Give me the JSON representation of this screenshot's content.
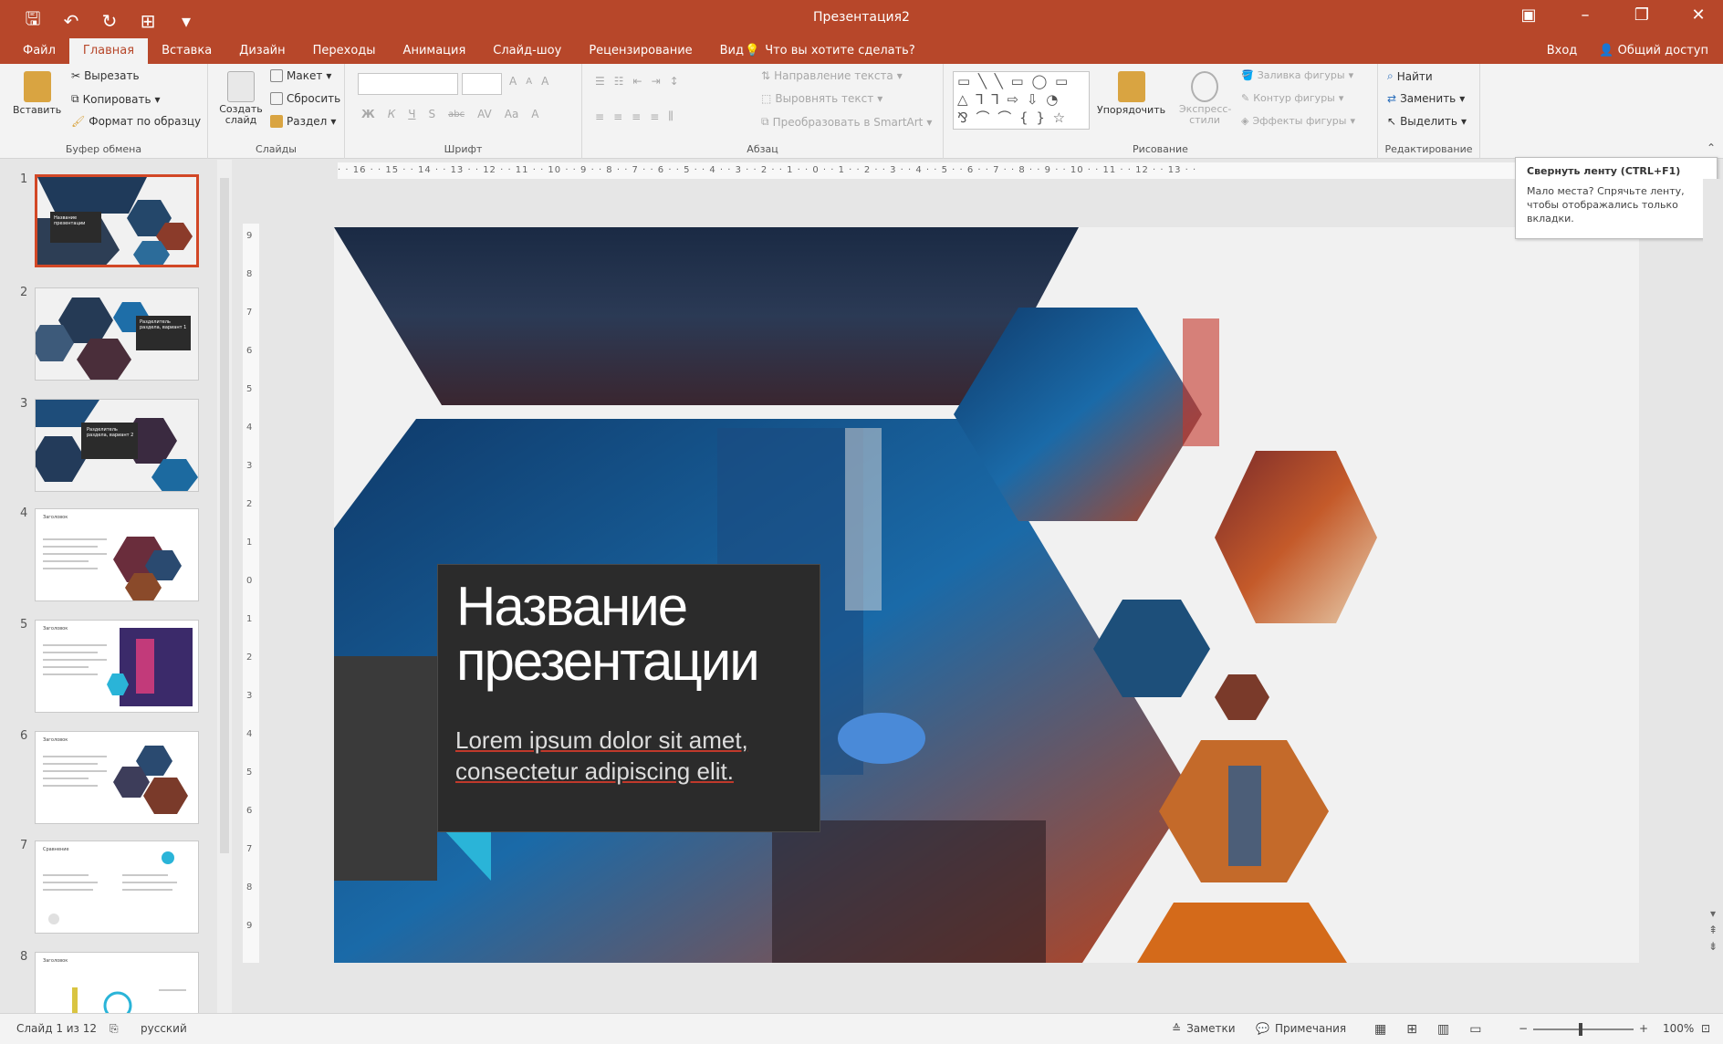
{
  "window": {
    "title": "Презентация2",
    "controls": {
      "minimize": "–",
      "maximize": "❐",
      "close": "✕",
      "ribbon_display": "▣"
    }
  },
  "qat": {
    "save": "🖫",
    "undo": "↶",
    "redo": "↻",
    "present": "⊞",
    "customize": "▾"
  },
  "tabs": [
    "Файл",
    "Главная",
    "Вставка",
    "Дизайн",
    "Переходы",
    "Анимация",
    "Слайд-шоу",
    "Рецензирование",
    "Вид"
  ],
  "active_tab": "Главная",
  "tellme": {
    "icon": "💡",
    "text": "Что вы хотите сделать?"
  },
  "account": {
    "signin": "Вход",
    "share": "Общий доступ"
  },
  "ribbon": {
    "clipboard": {
      "label": "Буфер обмена",
      "paste": "Вставить",
      "cut": "Вырезать",
      "copy": "Копировать",
      "format_painter": "Формат по образцу"
    },
    "slides": {
      "label": "Слайды",
      "new_slide": "Создать слайд",
      "layout": "Макет",
      "reset": "Сбросить",
      "section": "Раздел"
    },
    "font": {
      "label": "Шрифт",
      "grow": "A",
      "shrink": "A",
      "clear": "A",
      "bold": "Ж",
      "italic": "К",
      "underline": "Ч",
      "shadow": "S",
      "strike": "abc",
      "spacing": "AV",
      "case": "Aa",
      "color": "A"
    },
    "paragraph": {
      "label": "Абзац",
      "text_direction": "Направление текста",
      "align_text": "Выровнять текст",
      "smartart": "Преобразовать в SmartArt"
    },
    "drawing": {
      "label": "Рисование",
      "arrange": "Упорядочить",
      "quick_styles": "Экспресс-стили",
      "fill": "Заливка фигуры",
      "outline": "Контур фигуры",
      "effects": "Эффекты фигуры"
    },
    "editing": {
      "label": "Редактирование",
      "find": "Найти",
      "replace": "Заменить",
      "select": "Выделить"
    }
  },
  "ruler": {
    "horizontal": "· · 16 · · 15 · · 14 · · 13 · · 12 · · 11 · · 10 · · 9 · · 8 · · 7 · · 6 · · 5 · · 4 · · 3 · · 2 · · 1 · · 0 · · 1 · · 2 · · 3 · · 4 · · 5 · · 6 · · 7 · · 8 · · 9 · · 10 · · 11 · · 12 · · 13 · ·",
    "vertical": [
      "9",
      "8",
      "7",
      "6",
      "5",
      "4",
      "3",
      "2",
      "1",
      "0",
      "1",
      "2",
      "3",
      "4",
      "5",
      "6",
      "7",
      "8",
      "9"
    ]
  },
  "thumbnails": [
    {
      "num": "1",
      "selected": true,
      "title": "Название презентации"
    },
    {
      "num": "2",
      "selected": false,
      "title": "Разделитель раздела, вариант 1"
    },
    {
      "num": "3",
      "selected": false,
      "title": "Разделитель раздела, вариант 2"
    },
    {
      "num": "4",
      "selected": false,
      "title": "Заголовок"
    },
    {
      "num": "5",
      "selected": false,
      "title": "Заголовок"
    },
    {
      "num": "6",
      "selected": false,
      "title": "Заголовок"
    },
    {
      "num": "7",
      "selected": false,
      "title": "Сравнение"
    },
    {
      "num": "8",
      "selected": false,
      "title": "Заголовок"
    }
  ],
  "slide": {
    "title": "Название\nпрезентации",
    "subtitle": "Lorem ipsum dolor sit amet,\nconsectetur adipiscing elit.",
    "accent": "#2ab4d8"
  },
  "tooltip": {
    "title": "Свернуть ленту (CTRL+F1)",
    "body": "Мало места? Спрячьте ленту, чтобы отображались только вкладки."
  },
  "statusbar": {
    "slide_info": "Слайд 1 из 12",
    "language": "русский",
    "notes": "Заметки",
    "comments": "Примечания",
    "zoom": "100%",
    "zoom_minus": "−",
    "zoom_plus": "+"
  },
  "colors": {
    "brand": "#b7472a",
    "selected_thumb": "#d24726",
    "slide_bg": "#f1f1f1",
    "title_box": "#2b2b2b"
  }
}
